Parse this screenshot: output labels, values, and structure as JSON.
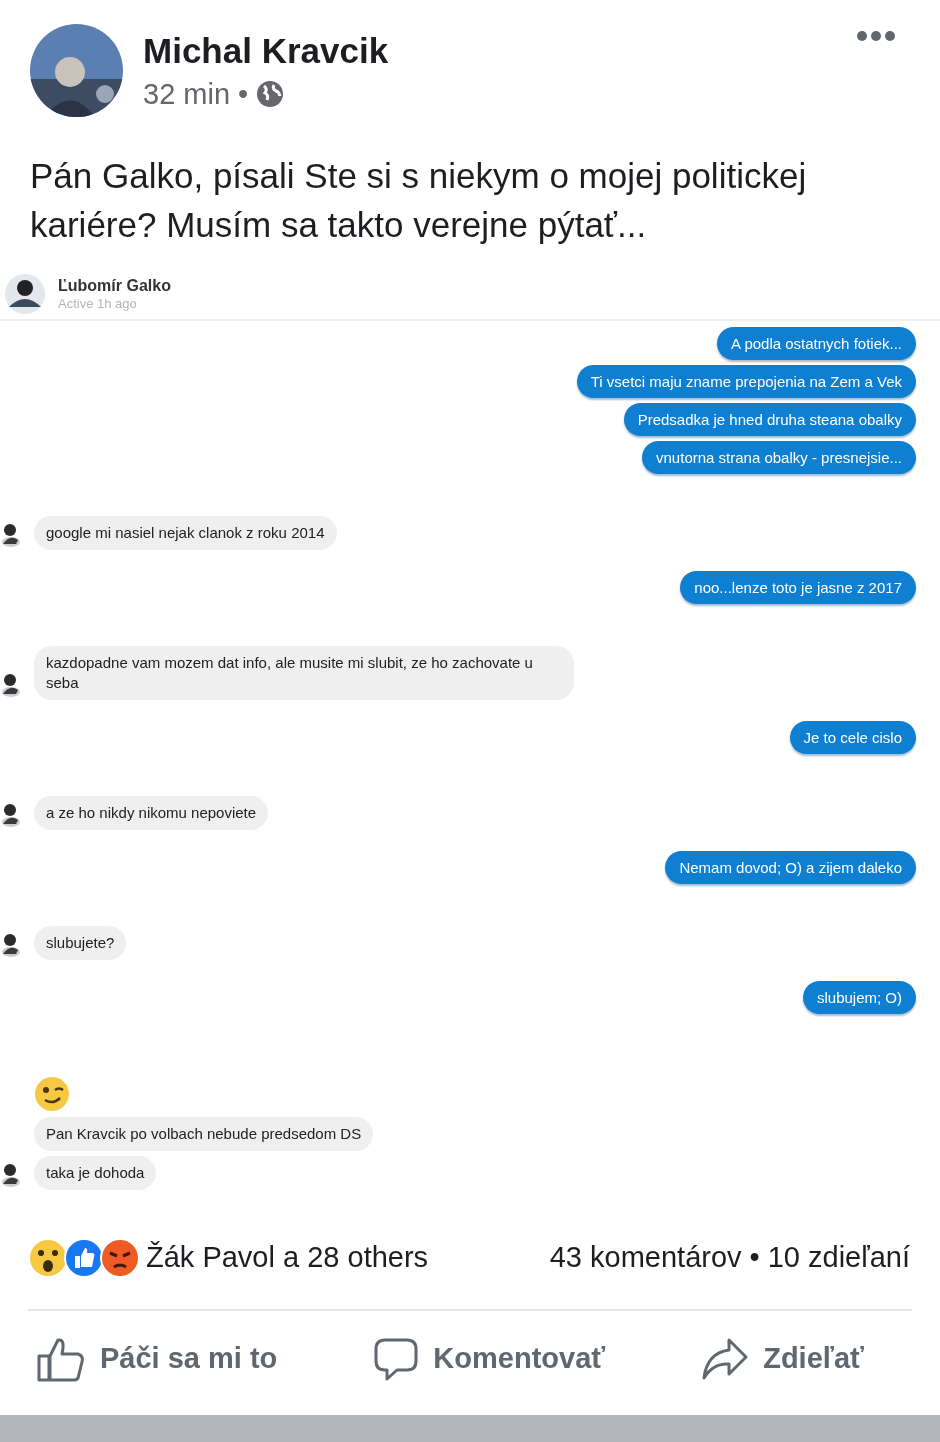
{
  "post": {
    "author": "Michal Kravcik",
    "time": "32 min",
    "separator": "•",
    "text": "Pán Galko, písali Ste si s niekym o mojej politickej kariére? Musím sa takto verejne pýtať..."
  },
  "chat": {
    "contact": "Ľubomír Galko",
    "status": "Active 1h ago",
    "messages": [
      {
        "kind": "text",
        "outgoing": true,
        "text": "A podla ostatnych fotiek..."
      },
      {
        "kind": "text",
        "outgoing": true,
        "text": "Ti vsetci maju zname prepojenia na Zem a Vek"
      },
      {
        "kind": "text",
        "outgoing": true,
        "text": "Predsadka je hned druha steana obalky"
      },
      {
        "kind": "text",
        "outgoing": true,
        "text": "vnutorna strana obalky - presnejsie..."
      },
      {
        "kind": "text",
        "outgoing": false,
        "text": "google mi nasiel nejak clanok z roku 2014"
      },
      {
        "kind": "text",
        "outgoing": true,
        "text": "noo...lenze toto je jasne z 2017"
      },
      {
        "kind": "text",
        "outgoing": false,
        "text": "kazdopadne vam mozem dat info, ale musite mi slubit, ze ho zachovate u seba"
      },
      {
        "kind": "text",
        "outgoing": true,
        "text": "Je to cele cislo"
      },
      {
        "kind": "text",
        "outgoing": false,
        "text": "a ze ho nikdy nikomu nepoviete"
      },
      {
        "kind": "text",
        "outgoing": true,
        "text": "Nemam dovod; O) a zijem daleko"
      },
      {
        "kind": "text",
        "outgoing": false,
        "text": "slubujete?"
      },
      {
        "kind": "text",
        "outgoing": true,
        "text": "slubujem; O)"
      },
      {
        "kind": "emoji"
      },
      {
        "kind": "text",
        "outgoing": false,
        "text": "Pan Kravcik po volbach nebude predsedom DS"
      },
      {
        "kind": "text",
        "outgoing": false,
        "text": "taka je dohoda"
      }
    ]
  },
  "reactions": {
    "names": "Žák Pavol a 28 others",
    "comments": "43 komentárov",
    "separator": "•",
    "shares": "10 zdieľaní"
  },
  "actions": [
    {
      "kind": "like",
      "label": "Páči sa mi to"
    },
    {
      "kind": "comment",
      "label": "Komentovať"
    },
    {
      "kind": "share",
      "label": "Zdieľať"
    }
  ]
}
